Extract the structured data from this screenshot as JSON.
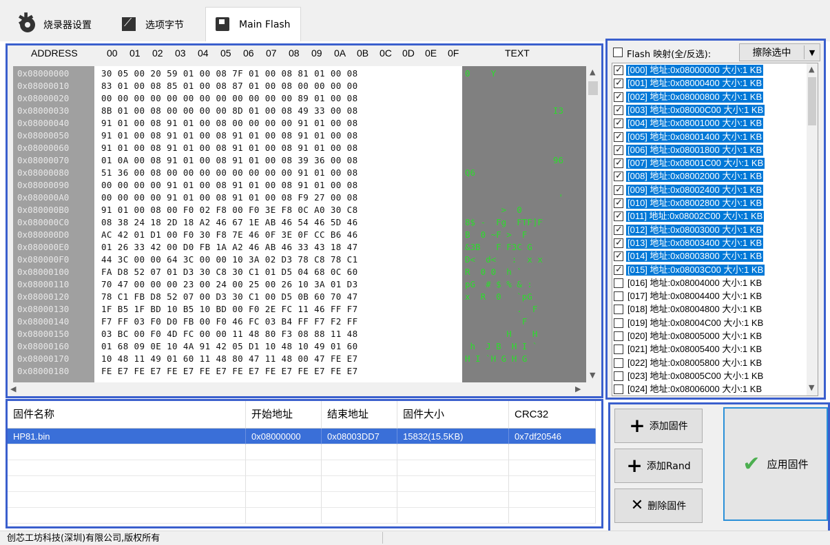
{
  "tabs": [
    {
      "label": "烧录器设置",
      "icon": "gear-icon"
    },
    {
      "label": "选项字节",
      "icon": "edit-icon"
    },
    {
      "label": "Main Flash",
      "icon": "disk-icon"
    }
  ],
  "hex": {
    "address_header": "ADDRESS",
    "col_headers": [
      "00",
      "01",
      "02",
      "03",
      "04",
      "05",
      "06",
      "07",
      "08",
      "09",
      "0A",
      "0B",
      "0C",
      "0D",
      "0E",
      "0F"
    ],
    "text_header": "TEXT",
    "addresses": [
      "0x08000000",
      "0x08000010",
      "0x08000020",
      "0x08000030",
      "0x08000040",
      "0x08000050",
      "0x08000060",
      "0x08000070",
      "0x08000080",
      "0x08000090",
      "0x080000A0",
      "0x080000B0",
      "0x080000C0",
      "0x080000D0",
      "0x080000E0",
      "0x080000F0",
      "0x08000100",
      "0x08000110",
      "0x08000120",
      "0x08000130",
      "0x08000140",
      "0x08000150",
      "0x08000160",
      "0x08000170",
      "0x08000180"
    ],
    "rows": [
      "30 05 00 20 59 01 00 08 7F 01 00 08 81 01 00 08",
      "83 01 00 08 85 01 00 08 87 01 00 08 00 00 00 00",
      "00 00 00 00 00 00 00 00 00 00 00 00 89 01 00 08",
      "8B 01 00 08 00 00 00 00 8D 01 00 08 49 33 00 08",
      "91 01 00 08 91 01 00 08 00 00 00 00 91 01 00 08",
      "91 01 00 08 91 01 00 08 91 01 00 08 91 01 00 08",
      "91 01 00 08 91 01 00 08 91 01 00 08 91 01 00 08",
      "01 0A 00 08 91 01 00 08 91 01 00 08 39 36 00 08",
      "51 36 00 08 00 00 00 00 00 00 00 00 91 01 00 08",
      "00 00 00 00 91 01 00 08 91 01 00 08 91 01 00 08",
      "00 00 00 00 91 01 00 08 91 01 00 08 F9 27 00 08",
      "91 01 00 08 00 F0 02 F8 00 F0 3E F8 0C A0 30 C8",
      "08 38 24 18 2D 18 A2 46 67 1E AB 46 54 46 5D 46",
      "AC 42 01 D1 00 F0 30 F8 7E 46 0F 3E 0F CC B6 46",
      "01 26 33 42 00 D0 FB 1A A2 46 AB 46 33 43 18 47",
      "44 3C 00 00 64 3C 00 00 10 3A 02 D3 78 C8 78 C1",
      "FA D8 52 07 01 D3 30 C8 30 C1 01 D5 04 68 0C 60",
      "70 47 00 00 00 23 00 24 00 25 00 26 10 3A 01 D3",
      "78 C1 FB D8 52 07 00 D3 30 C1 00 D5 0B 60 70 47",
      "1F B5 1F BD 10 B5 10 BD 00 F0 2E FC 11 46 FF F7",
      "F7 FF 03 F0 D0 FB 00 F0 46 FC 03 B4 FF F7 F2 FF",
      "03 BC 00 F0 4D FC 00 00 11 48 80 F3 08 88 11 48",
      "01 68 09 0E 10 4A 91 42 05 D1 10 48 10 49 01 60",
      "10 48 11 49 01 60 11 48 80 47 11 48 00 47 FE E7",
      "FE E7 FE E7 FE E7 FE E7 FE E7 FE E7 FE E7 FE E7"
    ],
    "text_rows": [
      "0    Y   ",
      "",
      "",
      "                 I3 ",
      "",
      "",
      "",
      "                 96 ",
      "Q6",
      "",
      "                  '",
      "       >  0 ",
      "8$ -  Fg  FTF]F",
      "B  0 ~F >  F",
      "&3B   F F3C G",
      "D<  d<   :  x x",
      "R  0 0  h `",
      "pG  # $ % & :",
      "x  R  0   `pG",
      "          .  F",
      "           F",
      "        H    H",
      " h  J B  H I `",
      "H I `H G H G",
      ""
    ]
  },
  "flash_map": {
    "header_label": "Flash 映射(全/反选):",
    "erase_label": "擦除选中",
    "items": [
      {
        "label": "[000] 地址:0x08000000 大小:1 KB",
        "checked": true
      },
      {
        "label": "[001] 地址:0x08000400 大小:1 KB",
        "checked": true
      },
      {
        "label": "[002] 地址:0x08000800 大小:1 KB",
        "checked": true
      },
      {
        "label": "[003] 地址:0x08000C00 大小:1 KB",
        "checked": true
      },
      {
        "label": "[004] 地址:0x08001000 大小:1 KB",
        "checked": true
      },
      {
        "label": "[005] 地址:0x08001400 大小:1 KB",
        "checked": true
      },
      {
        "label": "[006] 地址:0x08001800 大小:1 KB",
        "checked": true
      },
      {
        "label": "[007] 地址:0x08001C00 大小:1 KB",
        "checked": true
      },
      {
        "label": "[008] 地址:0x08002000 大小:1 KB",
        "checked": true
      },
      {
        "label": "[009] 地址:0x08002400 大小:1 KB",
        "checked": true
      },
      {
        "label": "[010] 地址:0x08002800 大小:1 KB",
        "checked": true
      },
      {
        "label": "[011] 地址:0x08002C00 大小:1 KB",
        "checked": true
      },
      {
        "label": "[012] 地址:0x08003000 大小:1 KB",
        "checked": true
      },
      {
        "label": "[013] 地址:0x08003400 大小:1 KB",
        "checked": true
      },
      {
        "label": "[014] 地址:0x08003800 大小:1 KB",
        "checked": true
      },
      {
        "label": "[015] 地址:0x08003C00 大小:1 KB",
        "checked": true
      },
      {
        "label": "[016] 地址:0x08004000 大小:1 KB",
        "checked": false
      },
      {
        "label": "[017] 地址:0x08004400 大小:1 KB",
        "checked": false
      },
      {
        "label": "[018] 地址:0x08004800 大小:1 KB",
        "checked": false
      },
      {
        "label": "[019] 地址:0x08004C00 大小:1 KB",
        "checked": false
      },
      {
        "label": "[020] 地址:0x08005000 大小:1 KB",
        "checked": false
      },
      {
        "label": "[021] 地址:0x08005400 大小:1 KB",
        "checked": false
      },
      {
        "label": "[022] 地址:0x08005800 大小:1 KB",
        "checked": false
      },
      {
        "label": "[023] 地址:0x08005C00 大小:1 KB",
        "checked": false
      },
      {
        "label": "[024] 地址:0x08006000 大小:1 KB",
        "checked": false
      }
    ]
  },
  "firmware": {
    "headers": [
      "固件名称",
      "开始地址",
      "结束地址",
      "固件大小",
      "CRC32"
    ],
    "rows": [
      [
        "HP81.bin",
        "0x08000000",
        "0x08003DD7",
        "15832(15.5KB)",
        "0x7df20546"
      ]
    ]
  },
  "buttons": {
    "add_firmware": "添加固件",
    "add_rand": "添加Rand",
    "delete_firmware": "删除固件",
    "apply_firmware": "应用固件"
  },
  "status": {
    "copyright": "创芯工坊科技(深圳)有限公司,版权所有"
  }
}
